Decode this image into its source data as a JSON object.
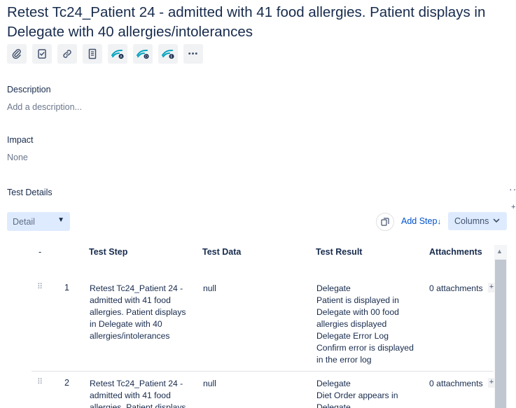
{
  "issue": {
    "title": "Retest Tc24_Patient 24 - admitted with 41 food allergies. Patient displays in Delegate with 40 allergies/intolerances"
  },
  "toolbar": {
    "icons": [
      "paperclip-icon",
      "checklist-icon",
      "link-icon",
      "document-icon",
      "app-a-icon",
      "app-d-icon",
      "app-e-icon",
      "more-icon"
    ],
    "more_label": "•••"
  },
  "description": {
    "label": "Description",
    "placeholder": "Add a description..."
  },
  "impact": {
    "label": "Impact",
    "value": "None"
  },
  "test_details": {
    "label": "Test Details",
    "more_label": "··",
    "view_select": "Detail",
    "add_step_label": "Add Step",
    "columns_label": "Columns"
  },
  "table": {
    "headers": {
      "sort": "-",
      "step": "Test Step",
      "data": "Test Data",
      "result": "Test Result",
      "attachments": "Attachments"
    },
    "rows": [
      {
        "num": "1",
        "step": "Retest Tc24_Patient 24 -\nadmitted with 41 food\nallergies. Patient displays\nin Delegate with 40\nallergies/intolerances",
        "data": "null",
        "result": "Delegate\nPatient is displayed in\nDelegate with 00 food\nallergies displayed\nDelegate Error Log\nConfirm error is displayed\nin the error log",
        "attachments": "0 attachments"
      },
      {
        "num": "2",
        "step": "Retest Tc24_Patient 24 -\nadmitted with 41 food\nallergies. Patient displays",
        "data": "null",
        "result": "Delegate\nDiet Order appears in\nDelegate",
        "attachments": "0 attachments"
      }
    ]
  },
  "colors": {
    "accent": "#0052cc",
    "select_bg": "#deebff",
    "icon_app": "#00a3bf"
  }
}
